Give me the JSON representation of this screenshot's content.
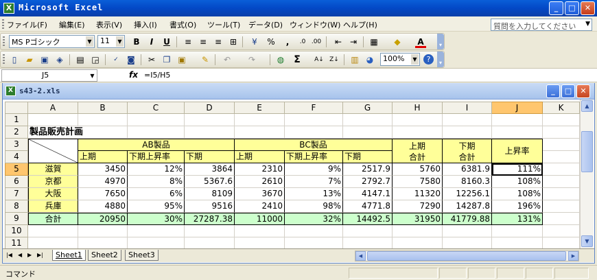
{
  "window": {
    "title": "Microsoft Excel",
    "app_icon": "X",
    "minimize": "_",
    "maximize": "□",
    "close": "✕"
  },
  "menu": {
    "items": [
      "ファイル(F)",
      "編集(E)",
      "表示(V)",
      "挿入(I)",
      "書式(O)",
      "ツール(T)",
      "データ(D)",
      "ウィンドウ(W)",
      "ヘルプ(H)"
    ],
    "help_placeholder": "質問を入力してください"
  },
  "format_toolbar": {
    "font_name": "MS Pゴシック",
    "font_size": "11",
    "bold": "B",
    "italic": "I",
    "underline": "U",
    "percent": "%",
    "comma": ","
  },
  "standard_toolbar": {
    "sigma": "Σ",
    "zoom": "100%"
  },
  "formula_bar": {
    "name_box": "J5",
    "fx": "fx",
    "formula": "=I5/H5"
  },
  "workbook": {
    "filename": "s43-2.xls",
    "minimize": "_",
    "maximize": "□",
    "close": "✕"
  },
  "columns": [
    "A",
    "B",
    "C",
    "D",
    "E",
    "F",
    "G",
    "H",
    "I",
    "J",
    "K"
  ],
  "rows": [
    "1",
    "2",
    "3",
    "4",
    "5",
    "6",
    "7",
    "8",
    "9",
    "10",
    "11"
  ],
  "selected_cell": {
    "column": "J",
    "row": "5"
  },
  "sheet": {
    "title": "製品販売計画",
    "group_ab": "AB製品",
    "group_bc": "BC製品",
    "sub_headers": {
      "first_half": "上期",
      "growth": "下期上昇率",
      "second_half": "下期"
    },
    "h_header": [
      "上期",
      "合計"
    ],
    "i_header": [
      "下期",
      "合計"
    ],
    "j_header": "上昇率",
    "data_rows": [
      {
        "name": "滋賀",
        "b": "3450",
        "c": "12%",
        "d": "3864",
        "e": "2310",
        "f": "9%",
        "g": "2517.9",
        "h": "5760",
        "i": "6381.9",
        "j": "111%"
      },
      {
        "name": "京都",
        "b": "4970",
        "c": "8%",
        "d": "5367.6",
        "e": "2610",
        "f": "7%",
        "g": "2792.7",
        "h": "7580",
        "i": "8160.3",
        "j": "108%"
      },
      {
        "name": "大阪",
        "b": "7650",
        "c": "6%",
        "d": "8109",
        "e": "3670",
        "f": "13%",
        "g": "4147.1",
        "h": "11320",
        "i": "12256.1",
        "j": "108%"
      },
      {
        "name": "兵庫",
        "b": "4880",
        "c": "95%",
        "d": "9516",
        "e": "2410",
        "f": "98%",
        "g": "4771.8",
        "h": "7290",
        "i": "14287.8",
        "j": "196%"
      }
    ],
    "total_row": {
      "name": "合計",
      "b": "20950",
      "c": "30%",
      "d": "27287.38",
      "e": "11000",
      "f": "32%",
      "g": "14492.5",
      "h": "31950",
      "i": "41779.88",
      "j": "131%"
    }
  },
  "sheet_tabs": [
    "Sheet1",
    "Sheet2",
    "Sheet3"
  ],
  "tab_nav": [
    "|◀",
    "◀",
    "▶",
    "▶|"
  ],
  "status": {
    "mode": "コマンド"
  },
  "colors": {
    "header_fill": "#ffff99",
    "total_fill": "#ccffcc",
    "selection_header": "#ffc66e"
  }
}
